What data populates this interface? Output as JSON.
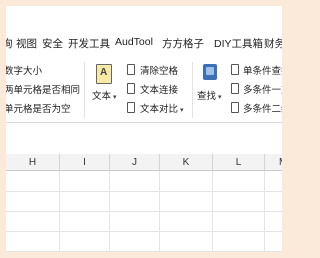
{
  "menu_tabs": [
    "询",
    "视图",
    "安全",
    "开发工具",
    "AudTool",
    "方方格子",
    "DIY工具箱",
    "财务工"
  ],
  "ribbon": {
    "left_items": [
      "数字大小",
      "两单元格是否相同",
      "单元格是否为空"
    ],
    "text_button": "文本",
    "text_tools": [
      "清除空格",
      "文本连接",
      "文本对比"
    ],
    "find_button": "查找",
    "find_tools": [
      "单条件查找",
      "多条件一对",
      "多条件二维"
    ]
  },
  "columns": [
    "H",
    "I",
    "J",
    "K",
    "L",
    "M"
  ]
}
